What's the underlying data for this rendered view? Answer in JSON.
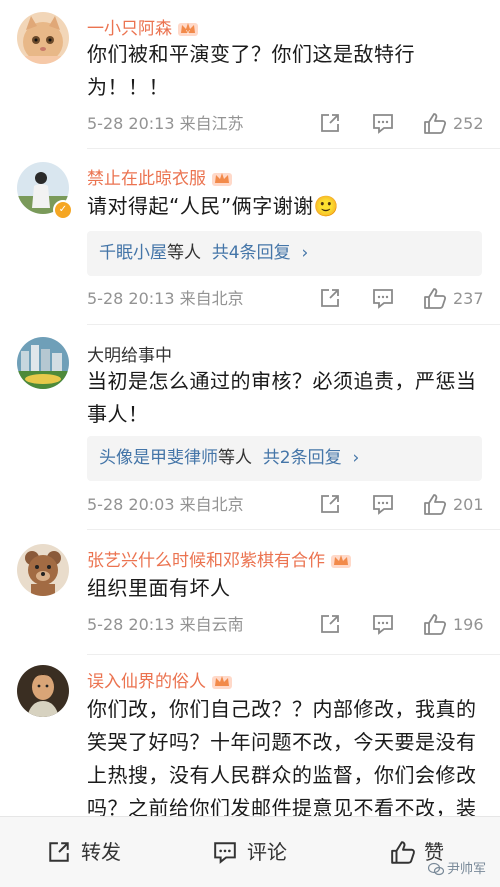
{
  "comments": [
    {
      "name": "一小只阿森",
      "vip": true,
      "text": "你们被和平演变了？你们这是敌特行为！！！",
      "time": "5-28 20:13 来自江苏",
      "likes": "252",
      "avatar": "cat"
    },
    {
      "name": "禁止在此晾衣服",
      "vip": true,
      "text": "请对得起“人民”俩字谢谢🙂",
      "replies_user": "千眠小屋",
      "replies_suffix": "等人",
      "replies_count": "共4条回复",
      "time": "5-28 20:13 来自北京",
      "likes": "237",
      "avatar": "person-sky"
    },
    {
      "name": "大明给事中",
      "vip": false,
      "text": "当初是怎么通过的审核？必须追责，严惩当事人！",
      "replies_user": "头像是甲斐律师",
      "replies_suffix": "等人",
      "replies_count": "共2条回复",
      "time": "5-28 20:03 来自北京",
      "likes": "201",
      "avatar": "city"
    },
    {
      "name": "张艺兴什么时候和邓紫棋有合作",
      "vip": true,
      "text": "组织里面有坏人",
      "time": "5-28 20:13 来自云南",
      "likes": "196",
      "avatar": "bear"
    },
    {
      "name": "误入仙界的俗人",
      "vip": true,
      "text": "你们改，你们自己改？？内部修改，我真的笑哭了好吗？十年问题不改，今天要是没有上热搜，没有人民群众的监督，你们会修改吗？之前给你们发邮件提意见不看不改，装",
      "avatar": "painting"
    }
  ],
  "bottom_bar": {
    "forward": "转发",
    "comment": "评论",
    "like": "赞"
  },
  "watermark": "尹帅军",
  "colors": {
    "vip_name": "#eb7350",
    "link": "#4475a8",
    "meta": "#939393"
  }
}
